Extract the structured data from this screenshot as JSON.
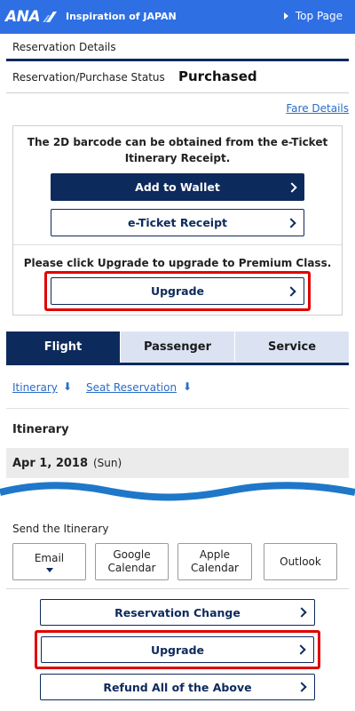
{
  "header": {
    "logo_text": "ANA",
    "tagline": "Inspiration of JAPAN",
    "top_page_link": "Top Page"
  },
  "reservation": {
    "section_title": "Reservation Details",
    "status_label": "Reservation/Purchase Status",
    "status_value": "Purchased",
    "fare_details_link": "Fare Details"
  },
  "ticket_panel": {
    "barcode_note_line1": "The 2D barcode can be obtained from the e-Ticket",
    "barcode_note_line2": "Itinerary Receipt.",
    "add_to_wallet": "Add to Wallet",
    "eticket_receipt": "e-Ticket Receipt",
    "upgrade_note": "Please click Upgrade to upgrade to Premium Class.",
    "upgrade_button": "Upgrade"
  },
  "tabs": [
    {
      "label": "Flight",
      "active": true
    },
    {
      "label": "Passenger",
      "active": false
    },
    {
      "label": "Service",
      "active": false
    }
  ],
  "anchors": {
    "itinerary": "Itinerary",
    "seat_reservation": "Seat Reservation",
    "arrow": "⬇"
  },
  "itinerary": {
    "title": "Itinerary",
    "date": "Apr 1, 2018",
    "day_of_week": "(Sun)"
  },
  "send": {
    "title": "Send the Itinerary",
    "options": {
      "email": "Email",
      "google_line1": "Google",
      "google_line2": "Calendar",
      "apple_line1": "Apple",
      "apple_line2": "Calendar",
      "outlook": "Outlook"
    }
  },
  "actions": {
    "reservation_change": "Reservation Change",
    "upgrade": "Upgrade",
    "refund_all": "Refund All of the Above"
  },
  "colors": {
    "brand_blue": "#2f6fe4",
    "navy": "#0d2a5c",
    "highlight_red": "#e00000",
    "link_blue": "#2a6bc9",
    "tab_inactive": "#dbe3f3"
  },
  "icons": {
    "top_page": "triangle-right-icon",
    "buttons": "chevron-right-icon",
    "anchors": "arrow-down-icon",
    "email": "caret-down-icon"
  }
}
